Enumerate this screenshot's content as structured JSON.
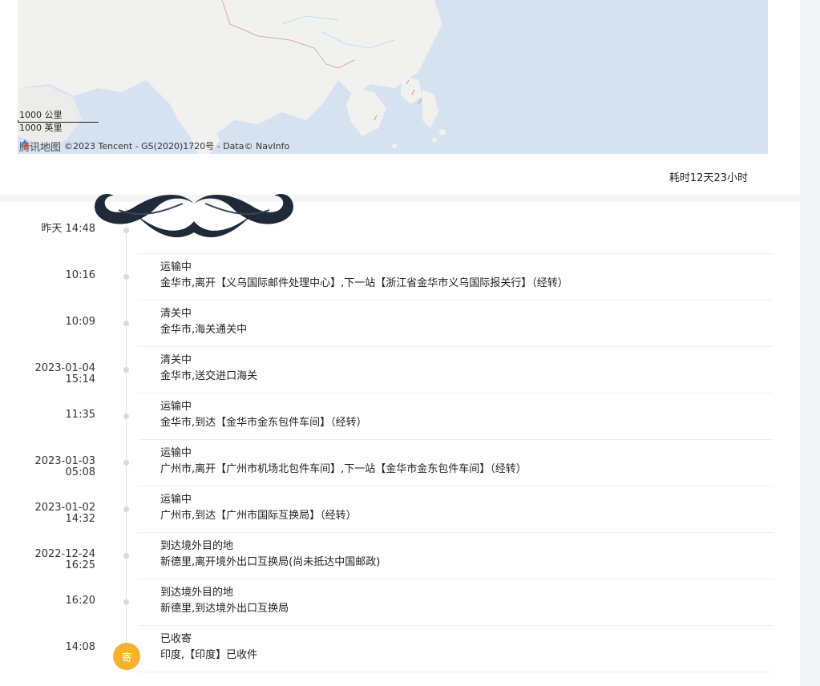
{
  "map": {
    "scale_km": "1000 公里",
    "scale_mi": "1000 英里",
    "brand": "腾讯地图",
    "copyright": "©2023 Tencent - GS(2020)1720号 - Data© NavInfo"
  },
  "duration": "耗时12天23小时",
  "events": [
    {
      "date": "昨天",
      "time": "14:48",
      "status": "",
      "detail": ""
    },
    {
      "date": "",
      "time": "10:16",
      "status": "运输中",
      "detail": "金华市,离开【义乌国际邮件处理中心】,下一站【浙江省金华市义乌国际报关行】（经转）"
    },
    {
      "date": "",
      "time": "10:09",
      "status": "清关中",
      "detail": "金华市,海关通关中"
    },
    {
      "date": "2023-01-04",
      "time": "15:14",
      "status": "清关中",
      "detail": "金华市,送交进口海关"
    },
    {
      "date": "",
      "time": "11:35",
      "status": "运输中",
      "detail": "金华市,到达【金华市金东包件车间】（经转）"
    },
    {
      "date": "2023-01-03",
      "time": "05:08",
      "status": "运输中",
      "detail": "广州市,离开【广州市机场北包件车间】,下一站【金华市金东包件车间】（经转）"
    },
    {
      "date": "2023-01-02",
      "time": "14:32",
      "status": "运输中",
      "detail": "广州市,到达【广州市国际互换局】（经转）"
    },
    {
      "date": "2022-12-24",
      "time": "16:25",
      "status": "到达境外目的地",
      "detail": "新德里,离开境外出口互换局(尚未抵达中国邮政)"
    },
    {
      "date": "",
      "time": "16:20",
      "status": "到达境外目的地",
      "detail": "新德里,到达境外出口互换局"
    },
    {
      "date": "",
      "time": "14:08",
      "status": "已收寄",
      "detail": "印度,【印度】已收件"
    }
  ],
  "start_badge": "寄",
  "colors": {
    "badge": "#f7b12e",
    "map_water": "#d6e2f0",
    "map_land": "#f1f1ef",
    "mustache": "#1f2a38"
  }
}
